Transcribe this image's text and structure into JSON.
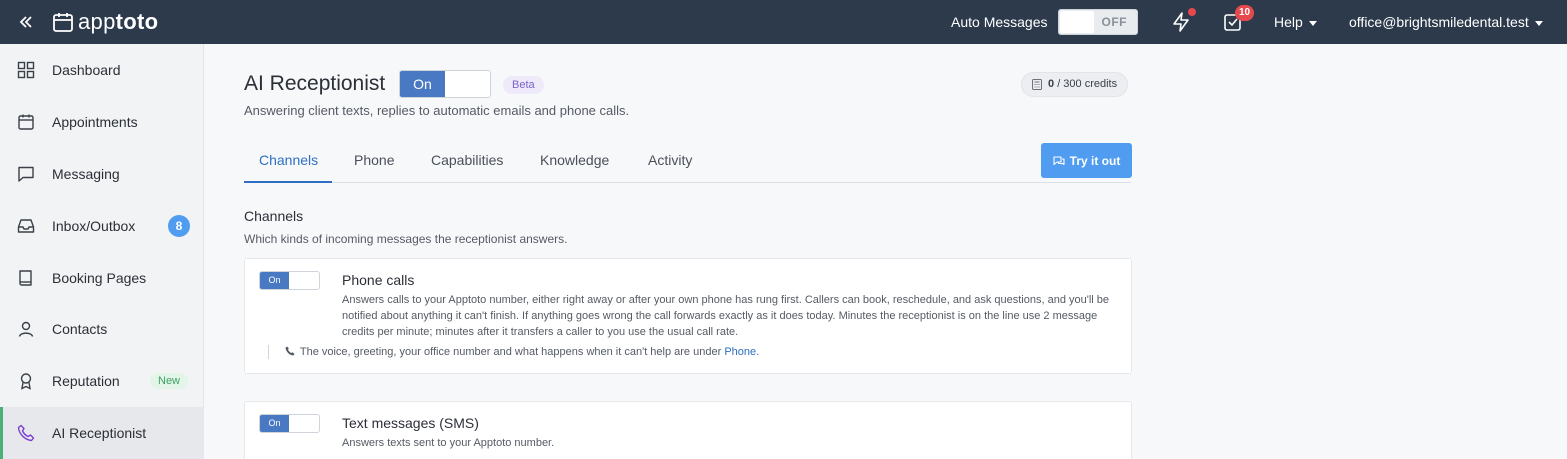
{
  "app": {
    "logo_text_light": "app",
    "logo_text_bold": "toto"
  },
  "topbar": {
    "auto_messages_label": "Auto Messages",
    "auto_messages_state": "OFF",
    "tasks_count": "10",
    "help_label": "Help",
    "account_label": "office@brightsmiledental.test"
  },
  "sidebar": {
    "items": [
      {
        "label": "Dashboard",
        "icon": "grid-icon"
      },
      {
        "label": "Appointments",
        "icon": "calendar-icon"
      },
      {
        "label": "Messaging",
        "icon": "chat-bubble-icon"
      },
      {
        "label": "Inbox/Outbox",
        "icon": "inbox-icon",
        "badge": "8"
      },
      {
        "label": "Booking Pages",
        "icon": "book-icon"
      },
      {
        "label": "Contacts",
        "icon": "person-icon"
      },
      {
        "label": "Reputation",
        "icon": "award-icon",
        "badge": "New"
      },
      {
        "label": "AI Receptionist",
        "icon": "phone-icon",
        "active": true
      }
    ]
  },
  "page": {
    "title": "AI Receptionist",
    "toggle_state": "On",
    "beta_label": "Beta",
    "subtitle": "Answering client texts, replies to automatic emails and phone calls.",
    "credits_used": "0",
    "credits_total": "/ 300 credits",
    "try_button": "Try it out",
    "tabs": [
      "Channels",
      "Phone",
      "Capabilities",
      "Knowledge",
      "Activity"
    ],
    "active_tab": "Channels"
  },
  "channels": {
    "title": "Channels",
    "subtitle": "Which kinds of incoming messages the receptionist answers.",
    "items": [
      {
        "toggle": "On",
        "title": "Phone calls",
        "description": "Answers calls to your Apptoto number, either right away or after your own phone has rung first. Callers can book, reschedule, and ask questions, and you'll be notified about anything it can't finish. If anything goes wrong the call forwards exactly as it does today. Minutes the receptionist is on the line use 2 message credits per minute; minutes after it transfers a caller to you use the usual call rate.",
        "note_text": "The voice, greeting, your office number and what happens when it can't help are under",
        "note_link": "Phone."
      },
      {
        "toggle": "On",
        "title": "Text messages (SMS)",
        "description": "Answers texts sent to your Apptoto number."
      }
    ]
  },
  "colors": {
    "topbar_bg": "#2c3a4b",
    "accent_blue": "#4f9cf0",
    "toggle_on": "#4a79c4",
    "tab_active": "#2f6fc3",
    "badge_red": "#e5484d"
  }
}
